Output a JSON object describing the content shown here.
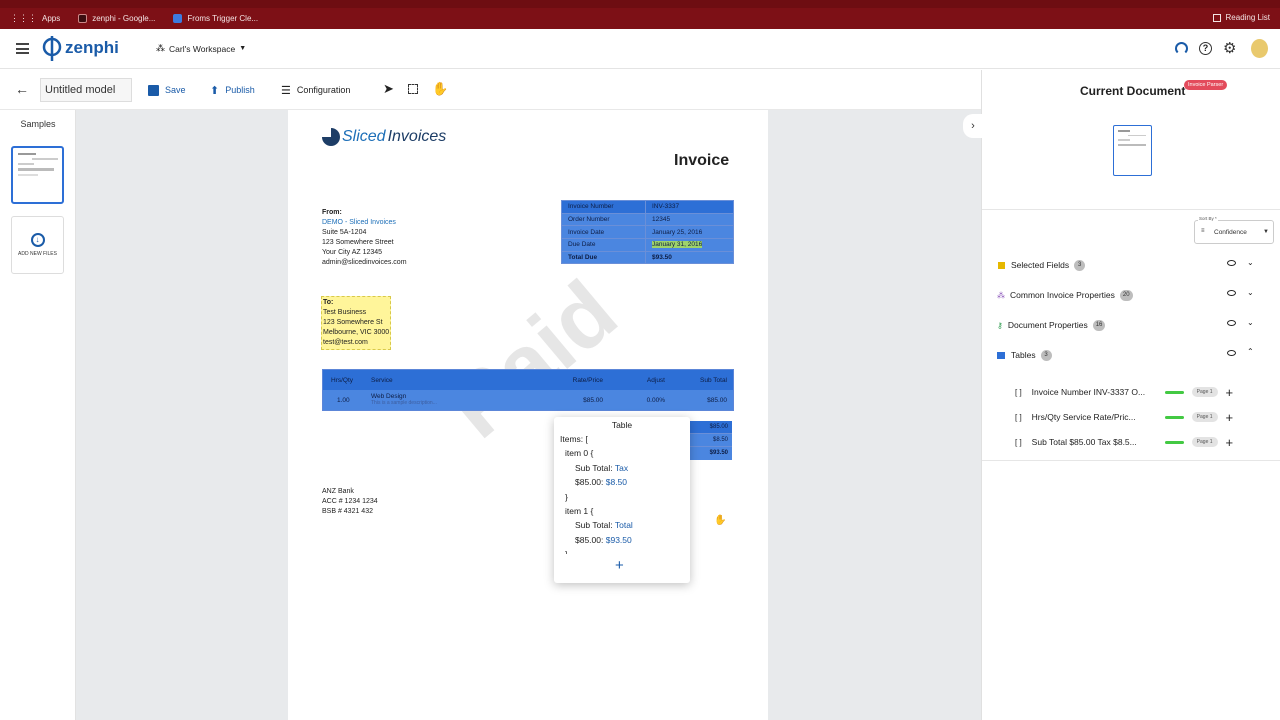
{
  "browser": {
    "bookmarks": [
      {
        "label": "Apps",
        "color": "#9ca3af"
      },
      {
        "label": "zenphi - Google...",
        "color": "#6b1c22"
      },
      {
        "label": "Froms Trigger Cle...",
        "color": "#3d7be0"
      }
    ],
    "reading_list": "Reading List"
  },
  "app": {
    "logo": "zenphi",
    "workspace": "Carl's Workspace"
  },
  "toolbar": {
    "model_name": "Untitled model",
    "save": "Save",
    "publish": "Publish",
    "configuration": "Configuration"
  },
  "samples": {
    "title": "Samples",
    "add_files": "ADD NEW FILES"
  },
  "invoice": {
    "brand_part1": "Sliced",
    "brand_part2": "Invoices",
    "title": "Invoice",
    "from_label": "From:",
    "from_name": "DEMO - Sliced Invoices",
    "from_lines": [
      "Suite 5A-1204",
      "123 Somewhere Street",
      "Your City AZ 12345",
      "admin@slicedinvoices.com"
    ],
    "to_label": "To:",
    "to_lines": [
      "Test Business",
      "123 Somewhere St",
      "Melbourne, VIC 3000",
      "test@test.com"
    ],
    "meta": [
      {
        "label": "Invoice Number",
        "value": "INV-3337"
      },
      {
        "label": "Order Number",
        "value": "12345"
      },
      {
        "label": "Invoice Date",
        "value": "January 25, 2016"
      },
      {
        "label": "Due Date",
        "value": "January 31, 2016"
      },
      {
        "label": "Total Due",
        "value": "$93.50"
      }
    ],
    "columns": [
      "Hrs/Qty",
      "Service",
      "Rate/Price",
      "Adjust",
      "Sub Total"
    ],
    "line": {
      "qty": "1.00",
      "service": "Web Design",
      "desc": "This is a sample description...",
      "rate": "$85.00",
      "adjust": "0.00%",
      "sub": "$85.00"
    },
    "totals": [
      "$85.00",
      "$8.50",
      "$93.50"
    ],
    "watermark": "Paid",
    "bank_lines": [
      "ANZ Bank",
      "ACC # 1234 1234",
      "BSB # 4321 432"
    ]
  },
  "popup": {
    "title": "Table",
    "lines": [
      {
        "k": "Items: [",
        "v": "",
        "indent": 0
      },
      {
        "k": "item 0 {",
        "v": "",
        "indent": 1
      },
      {
        "k": "Sub Total:",
        "v": " Tax",
        "indent": 2
      },
      {
        "k": "$85.00:",
        "v": " $8.50",
        "indent": 2
      },
      {
        "k": "}",
        "v": "",
        "indent": 1
      },
      {
        "k": "item 1 {",
        "v": "",
        "indent": 1
      },
      {
        "k": "Sub Total:",
        "v": " Total",
        "indent": 2
      },
      {
        "k": "$85.00:",
        "v": " $93.50",
        "indent": 2
      },
      {
        "k": "}",
        "v": "",
        "indent": 1
      }
    ]
  },
  "panel": {
    "title": "Current Document",
    "tag": "Invoice Parser",
    "sort_label": "Sort By *",
    "sort_value": "Confidence",
    "groups": [
      {
        "label": "Selected Fields",
        "count": "3",
        "color": "#e6b800"
      },
      {
        "label": "Common Invoice Properties",
        "count": "20",
        "color": "#7b3fb0"
      },
      {
        "label": "Document Properties",
        "count": "16",
        "color": "#2e9b4f"
      },
      {
        "label": "Tables",
        "count": "3",
        "color": "#2d6fd6"
      }
    ],
    "tables": [
      {
        "label": "Invoice Number INV-3337 O...",
        "page": "Page 1"
      },
      {
        "label": "Hrs/Qty Service Rate/Pric...",
        "page": "Page 1"
      },
      {
        "label": "Sub Total $85.00 Tax $8.5...",
        "page": "Page 1"
      }
    ]
  },
  "colors": {
    "accent": "#1a5ba8",
    "selection": "#2d6fd6",
    "highlight": "#fff59a",
    "confidence": "#43c943",
    "tag": "#e34b5c"
  }
}
